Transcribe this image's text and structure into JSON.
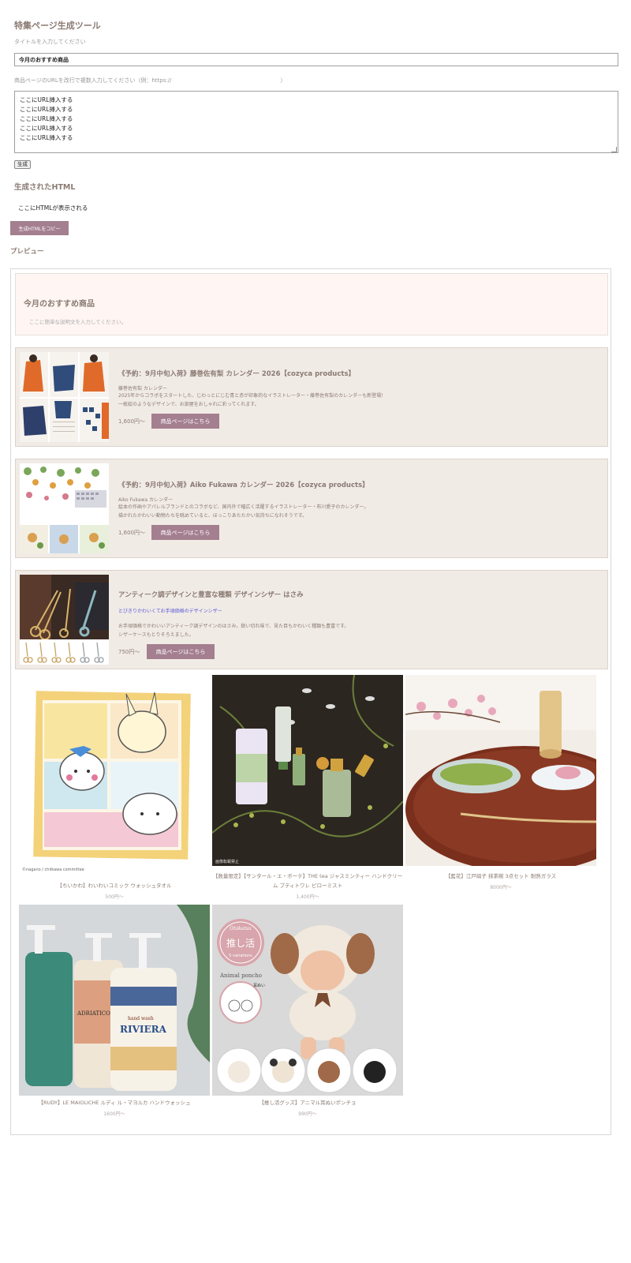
{
  "tool": {
    "title": "特集ページ生成ツール",
    "title_label": "タイトルを入力してください",
    "title_value": "今月のおすすめ商品",
    "url_label": "商品ページのURLを改行で複数入力してください（例：https://",
    "url_label_end": "）",
    "url_lines": "ここにURL挿入する\nここにURL挿入する\nここにURL挿入する\nここにURL挿入する\nここにURL挿入する",
    "generate_label": "生成"
  },
  "output": {
    "heading": "生成されたHTML",
    "placeholder": "ここにHTMLが表示される",
    "copy_label": "生成HTMLをコピー"
  },
  "preview": {
    "heading": "プレビュー",
    "hero_title": "今月のおすすめ商品",
    "hero_desc": "ここに簡単な説明文を入力してください。",
    "featured": [
      {
        "title": "《予約：9月中旬入荷》藤巻佐有梨 カレンダー 2026【cozyca products】",
        "subtitle": "藤巻佐有梨 カレンダー",
        "desc1": "2025年からコラボをスタートした、じわっとにじむ青と赤が印象的なイラストレーター・藤巻佐有梨のカレンダーも新登場！",
        "desc2": "一枚絵のようなデザインで、お部屋をおしゃれに彩ってくれます。",
        "price": "1,600円〜",
        "button": "商品ページはこちら"
      },
      {
        "title": "《予約：9月中旬入荷》Aiko Fukawa カレンダー 2026【cozyca products】",
        "subtitle": "Aiko Fukawa カレンダー",
        "desc1": "絵本の作画やアパレルブランドとのコラボなど、国内外で幅広く活躍するイラストレーター・布川愛子のカレンダー。",
        "desc2": "描かれたかわいい動物たちを眺めていると、ほっこりあたたかい気持ちになれそうです。",
        "price": "1,600円〜",
        "button": "商品ページはこちら"
      },
      {
        "title": "アンティーク調デザインと豊富な種類 デザインシザー はさみ",
        "subtitle": "とびきりかわいくてお手頃価格のデザインシザー",
        "desc1": "お手頃価格でかわいいアンティーク調デザインのはさみ。鋭い切れ味で、見た目もかわいく種類も豊富です。",
        "desc2": "シザーケースもとりそろえました。",
        "price": "750円〜",
        "button": "商品ページはこちら"
      }
    ],
    "products": [
      {
        "name": "【ちいかわ】わいわいコミック ウォッシュタオル",
        "price": "500円〜",
        "img_caption": "©nagano / chiikawa committee"
      },
      {
        "name": "【数量限定】【サンタール・エ・ボーテ】THE tea ジャスミンティー ハンドクリーム プティトワレ ピローミスト",
        "price": "1,400円〜",
        "img_caption": "画像転載禁止"
      },
      {
        "name": "【藍花】江戸硝子 抹茶碗 3点セット 耐熱ガラス",
        "price": "8000円〜",
        "img_caption": ""
      },
      {
        "name": "【RUDY】LE MAIOLICHE ルディ ル・マヨルカ ハンドウォッシュ",
        "price": "1600円〜",
        "img_caption": ""
      },
      {
        "name": "【推し活グッズ】アニマル耳ぬいポンチョ",
        "price": "990円〜",
        "img_caption": ""
      }
    ],
    "poncho_image": {
      "brand": "Otakatsu",
      "badge": "推し活",
      "variations": "5 variations",
      "product_en": "Animal poncho",
      "ear_label": "耳ぬい"
    },
    "soap_image": {
      "label_left": "ADRIATICO",
      "label_right": "RIVIERA",
      "label_top": "hand wash"
    }
  }
}
